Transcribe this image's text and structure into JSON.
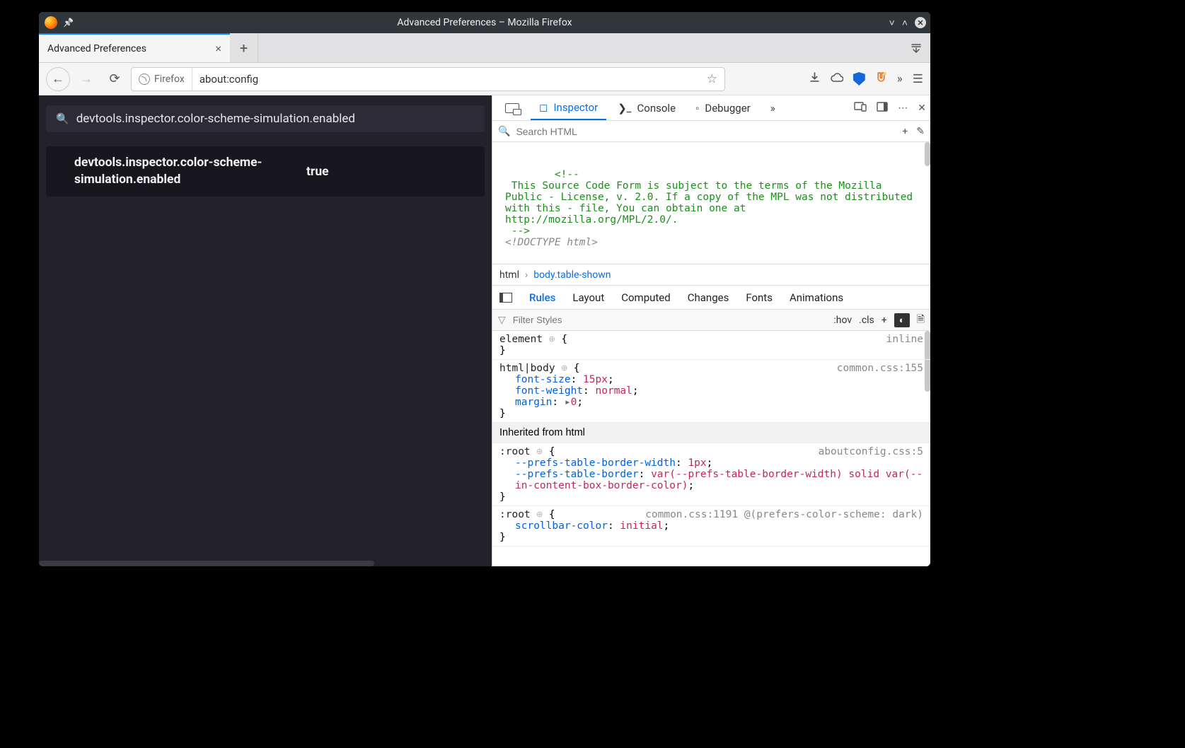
{
  "window": {
    "title": "Advanced Preferences – Mozilla Firefox"
  },
  "tab": {
    "title": "Advanced Preferences"
  },
  "urlbar": {
    "identity": "Firefox",
    "url": "about:config"
  },
  "aboutconfig": {
    "search": "devtools.inspector.color-scheme-simulation.enabled",
    "pref_name": "devtools.inspector.color-scheme-simulation.enabled",
    "pref_value": "true"
  },
  "devtools": {
    "tabs": {
      "inspector": "Inspector",
      "console": "Console",
      "debugger": "Debugger"
    },
    "search_placeholder": "Search HTML",
    "tree": {
      "comment": "<!--\n This Source Code Form is subject to the terms of the Mozilla Public - License, v. 2.0. If a copy of the MPL was not distributed with this - file, You can obtain one at http://mozilla.org/MPL/2.0/.\n -->",
      "doctype": "<!DOCTYPE html>"
    },
    "breadcrumb": {
      "a": "html",
      "b": "body.table-shown"
    },
    "subtabs": {
      "rules": "Rules",
      "layout": "Layout",
      "computed": "Computed",
      "changes": "Changes",
      "fonts": "Fonts",
      "animations": "Animations"
    },
    "filter": {
      "placeholder": "Filter Styles",
      "hov": ":hov",
      "cls": ".cls"
    },
    "rules": {
      "r0": {
        "sel": "element",
        "src": "inline"
      },
      "r1": {
        "sel": "html|body",
        "src": "common.css:155",
        "d0p": "font-size",
        "d0v": "15px",
        "d1p": "font-weight",
        "d1v": "normal",
        "d2p": "margin",
        "d2v": "0"
      },
      "inh": "Inherited from html",
      "r2": {
        "sel": ":root",
        "src": "aboutconfig.css:5",
        "d0p": "--prefs-table-border-width",
        "d0v": "1px",
        "d1p": "--prefs-table-border",
        "d1v": "var(--prefs-table-border-width) solid var(--in-content-box-border-color)"
      },
      "r3": {
        "sel": ":root",
        "src": "common.css:1191 @(prefers-color-scheme: dark)",
        "d0p": "scrollbar-color",
        "d0v": "initial"
      }
    }
  }
}
